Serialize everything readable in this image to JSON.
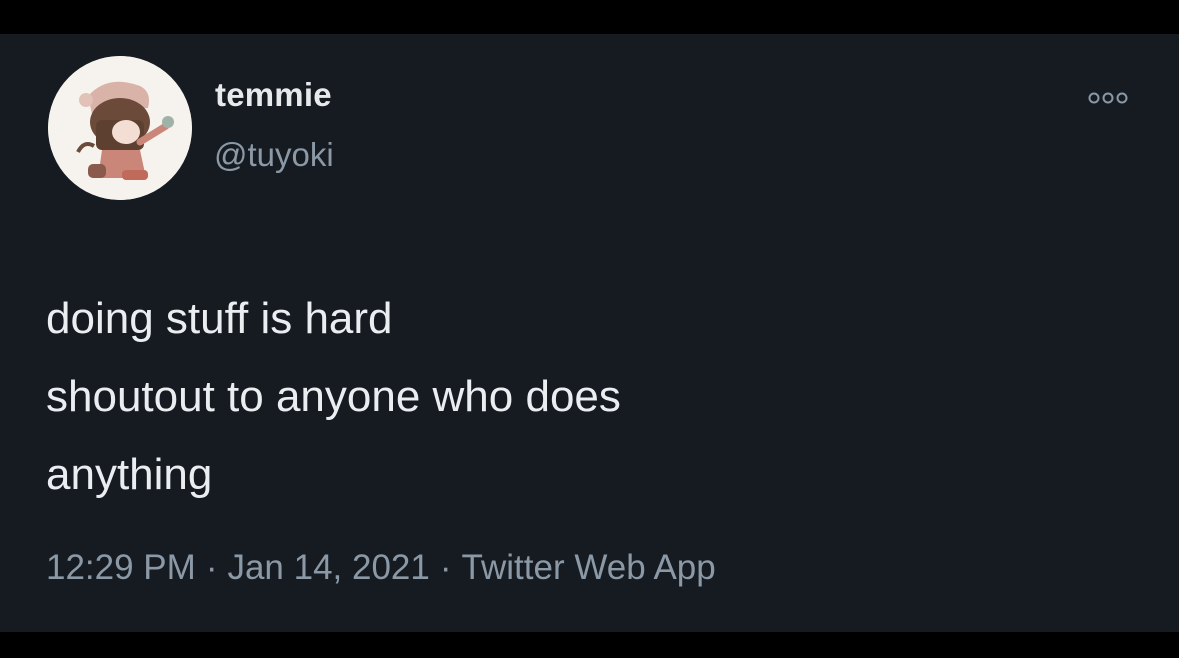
{
  "tweet": {
    "author": {
      "display_name": "temmie",
      "handle": "@tuyoki",
      "avatar_icon": "anime-avatar"
    },
    "more_icon": "more-options-icon",
    "text_lines": [
      "doing stuff is hard",
      "shoutout to anyone who does",
      "anything"
    ],
    "time": "12:29 PM",
    "separator": "·",
    "date": "Jan 14, 2021",
    "source": "Twitter Web App"
  },
  "colors": {
    "page_bg": "#000000",
    "card_bg": "#161b22",
    "primary_text": "#e7e9ea",
    "secondary_text": "#8b98a5"
  }
}
